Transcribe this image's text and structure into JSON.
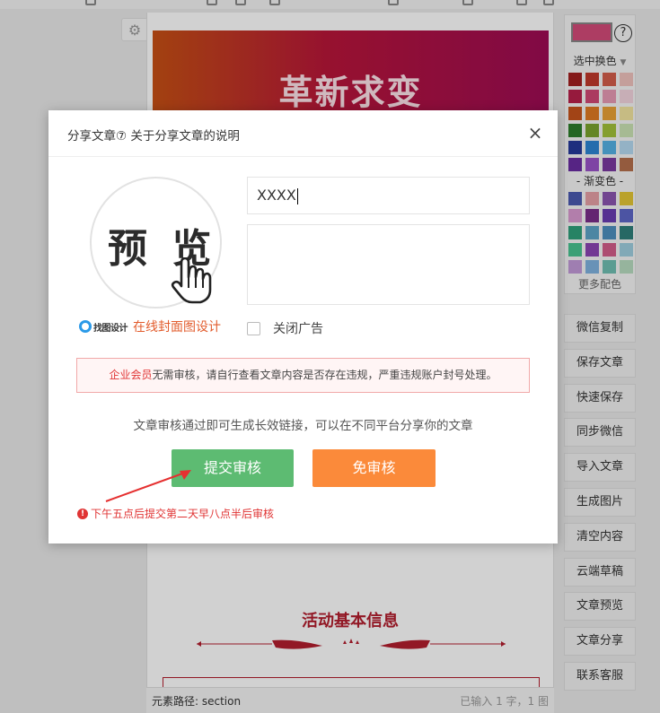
{
  "editor": {
    "banner_title": "革新求变",
    "section_title": "活动基本信息",
    "status_path": "元素路径:  section",
    "status_count": "已输入 1 字，1 图"
  },
  "palette": {
    "selected_color": "#d44b79",
    "help": "?",
    "swap_label": "选中换色",
    "gradient_label": "- 渐变色 -",
    "more_label": "更多配色",
    "solid_colors": [
      "#a21f1f",
      "#c0392b",
      "#d35d4b",
      "#efc3bd",
      "#b8204b",
      "#d14876",
      "#e79ab4",
      "#f3d5df",
      "#c6531b",
      "#e07a23",
      "#e9a237",
      "#f2e4a0",
      "#2d7d2b",
      "#7aa42e",
      "#a3c13a",
      "#cbe3b4",
      "#253a9a",
      "#2d86d3",
      "#55b1e5",
      "#b5daf1",
      "#6a2da1",
      "#9a53c8",
      "#7a3aa0",
      "#b56f4c"
    ],
    "gradient_colors": [
      "#4a59b0",
      "#e6a0a6",
      "#8b55b0",
      "#e3c635",
      "#d99ad1",
      "#7a2e8a",
      "#6a3cb3",
      "#5d67c7",
      "#2fa07a",
      "#5da4c7",
      "#4d8fbf",
      "#2f7f7a",
      "#49c490",
      "#8b45b4",
      "#d35d8a",
      "#9fcfe0",
      "#c39ad8",
      "#7fb2e0",
      "#6fbfb2",
      "#b8dcc0"
    ]
  },
  "sidebar_buttons": [
    "微信复制",
    "保存文章",
    "快速保存",
    "同步微信",
    "导入文章",
    "生成图片",
    "清空内容",
    "云端草稿",
    "文章预览",
    "文章分享",
    "联系客服"
  ],
  "dialog": {
    "title": "分享文章⑦ 关于分享文章的说明",
    "close": "×",
    "preview_text": "预 览",
    "logo_text": "找图设计",
    "cover_link": "在线封面图设计",
    "title_value": "XXXX",
    "desc_value": "",
    "close_ad_label": "关闭广告",
    "notice_highlight": "企业会员",
    "notice_text": "无需审核，请自行查看文章内容是否存在违规，严重违规账户封号处理。",
    "info_text": "文章审核通过即可生成长效链接，可以在不同平台分享你的文章",
    "submit_label": "提交审核",
    "skip_label": "免审核",
    "warning_icon": "!",
    "warning_text": "下午五点后提交第二天早八点半后审核"
  }
}
